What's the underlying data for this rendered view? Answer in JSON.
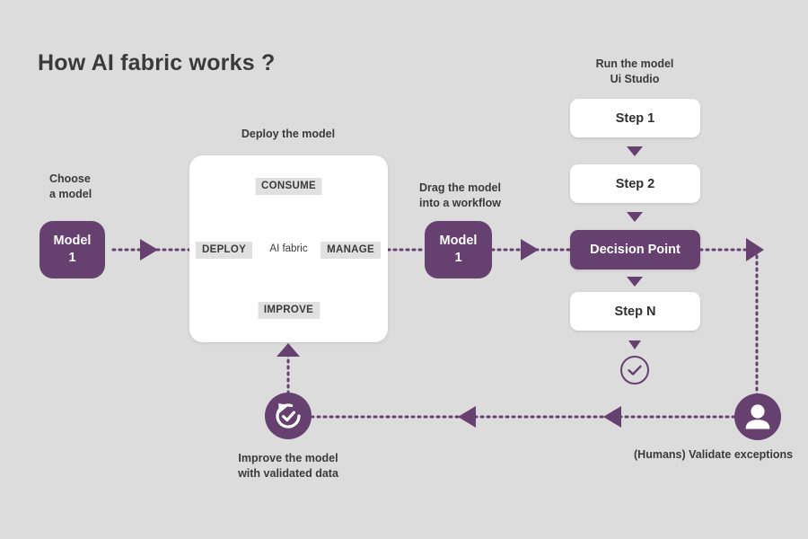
{
  "page": {
    "title": "How AI fabric works ?",
    "background_color": "#dcdcdc",
    "accent_color": "#66406f",
    "text_color": "#3a3a3a",
    "card_color": "#ffffff",
    "label_chip_color": "#e0e0e0"
  },
  "choose": {
    "caption": "Choose\na model",
    "model_label": "Model\n1"
  },
  "deploy": {
    "caption": "Deploy the model",
    "center_label": "AI fabric",
    "cycle_steps": [
      "CONSUME",
      "MANAGE",
      "IMPROVE",
      "DEPLOY"
    ]
  },
  "drag": {
    "caption": "Drag the model\ninto a workflow",
    "model_label": "Model\n1"
  },
  "run": {
    "caption": "Run the model\nUi Studio",
    "steps": [
      {
        "label": "Step 1",
        "kind": "step"
      },
      {
        "label": "Step 2",
        "kind": "step"
      },
      {
        "label": "Decision Point",
        "kind": "decision"
      },
      {
        "label": "Step N",
        "kind": "step"
      }
    ],
    "end_icon": "check-circle-icon"
  },
  "humans": {
    "caption": "(Humans) Validate exceptions",
    "icon": "person-icon"
  },
  "improve": {
    "caption": "Improve the model\nwith validated data",
    "icon": "refresh-check-icon"
  },
  "icons": {
    "arrow_right": "arrow-right-icon",
    "arrow_left": "arrow-left-icon",
    "arrow_up": "arrow-up-icon",
    "arrow_down": "arrow-down-icon"
  }
}
